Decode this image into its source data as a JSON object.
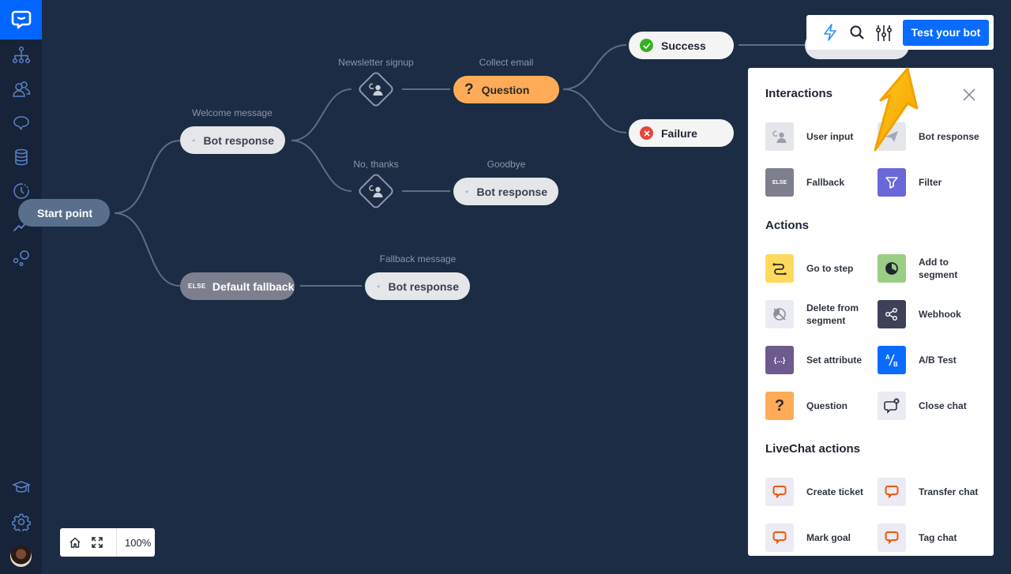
{
  "sidebar": {
    "logo": "livechat-chatbot-logo",
    "items": [
      {
        "name": "stories",
        "icon": "sitemap-icon"
      },
      {
        "name": "audience",
        "icon": "users-icon"
      },
      {
        "name": "training",
        "icon": "brain-icon"
      },
      {
        "name": "data",
        "icon": "database-icon"
      },
      {
        "name": "history",
        "icon": "history-icon"
      },
      {
        "name": "reports",
        "icon": "trend-icon"
      },
      {
        "name": "integrations",
        "icon": "integrations-icon"
      }
    ],
    "bottom_items": [
      {
        "name": "academy",
        "icon": "graduation-cap-icon"
      },
      {
        "name": "settings",
        "icon": "gear-icon"
      }
    ]
  },
  "flow": {
    "start": {
      "label": "Start point"
    },
    "welcome": {
      "title": "Welcome message",
      "label": "Bot response"
    },
    "newsletter": {
      "title": "Newsletter signup"
    },
    "no_thanks": {
      "title": "No, thanks"
    },
    "collect_email": {
      "title": "Collect email",
      "label": "Question"
    },
    "goodbye": {
      "title": "Goodbye",
      "label": "Bot response"
    },
    "success": {
      "label": "Success"
    },
    "failure": {
      "label": "Failure"
    },
    "default_fallback": {
      "tag": "ELSE",
      "label": "Default fallback"
    },
    "fallback_message": {
      "title": "Fallback message",
      "label": "Bot response"
    }
  },
  "toolbar": {
    "test_button": "Test your bot"
  },
  "panel": {
    "sections": [
      {
        "title": "Interactions",
        "items": [
          {
            "label": "User input",
            "color": "#e4e6ea"
          },
          {
            "label": "Bot response",
            "color": "#e4e6ea"
          },
          {
            "label": "Fallback",
            "color": "#7d7f8e",
            "tag": "ELSE"
          },
          {
            "label": "Filter",
            "color": "#6a67d8"
          }
        ]
      },
      {
        "title": "Actions",
        "items": [
          {
            "label": "Go to step",
            "color": "#ffd95c"
          },
          {
            "label": "Add to segment",
            "color": "#9ccd84"
          },
          {
            "label": "Delete from segment",
            "color": "#ebecf3"
          },
          {
            "label": "Webhook",
            "color": "#3e4158"
          },
          {
            "label": "Set attribute",
            "color": "#6d5a8e",
            "tag": "{...}"
          },
          {
            "label": "A/B Test",
            "color": "#0a6cff"
          },
          {
            "label": "Question",
            "color": "#ffab57",
            "tag": "?"
          },
          {
            "label": "Close chat",
            "color": "#ebecf3"
          }
        ]
      },
      {
        "title": "LiveChat actions",
        "items": [
          {
            "label": "Create ticket",
            "color": "#ebecf3"
          },
          {
            "label": "Transfer chat",
            "color": "#ebecf3"
          },
          {
            "label": "Mark goal",
            "color": "#ebecf3"
          },
          {
            "label": "Tag chat",
            "color": "#ebecf3"
          }
        ]
      }
    ]
  },
  "zoom": {
    "level": "100%"
  },
  "colors": {
    "accent": "#0a6cff",
    "canvas_bg": "#1c2c44",
    "sidebar_bg": "#172338",
    "question": "#ffab57",
    "success": "#35b31f",
    "failure": "#e8453c",
    "livechat_orange": "#ff5100",
    "annotation_arrow": "#ffb400"
  }
}
